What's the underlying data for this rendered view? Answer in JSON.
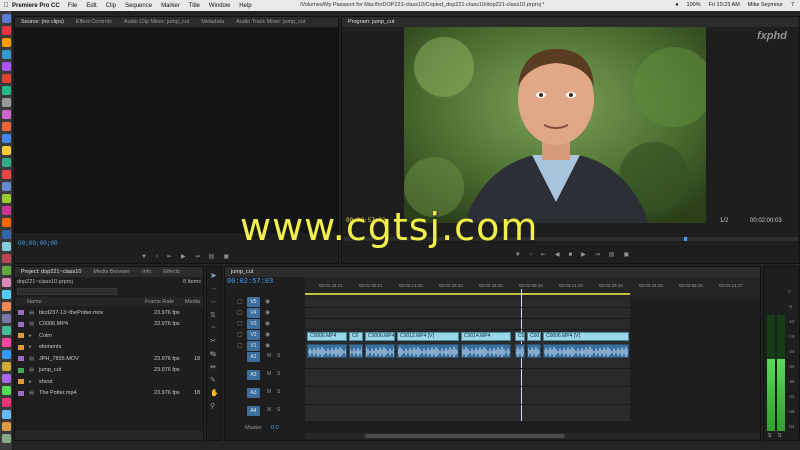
{
  "menubar": {
    "app": "Premiere Pro CC",
    "items": [
      "File",
      "Edit",
      "Clip",
      "Sequence",
      "Marker",
      "Title",
      "Window",
      "Help"
    ],
    "path": "/Volumes/My Passport for Mac/forDOP221-class10/Copied_dop221-class10/dop221-class10.prproj *",
    "battery": "100%",
    "time": "Fri 10:23 AM",
    "user": "Mike Seymour",
    "badge": "7"
  },
  "source_panel": {
    "tabs": [
      "Source: (no clips)",
      "Effect Controls",
      "Audio Clip Mixer: jump_cut",
      "Metadata",
      "Audio Track Mixer: jump_cut"
    ],
    "timecode": "00;00;00;00"
  },
  "program_panel": {
    "tab": "Program: jump_cut",
    "logo": "fxphd",
    "timecode_current": "00:02:57:03",
    "zoom": "1/2",
    "timecode_duration": "00:02:00:03"
  },
  "project_panel": {
    "tabs": [
      "Project: dop221~class10",
      "Media Browser",
      "Info",
      "Effects"
    ],
    "file": "dop221~class10.prproj",
    "items_count": "8 Items",
    "columns": [
      "Name",
      "Frame Rate",
      "Media"
    ],
    "rows": [
      {
        "name": "blcd237-13~thePotter.mov",
        "fps": "23.976 fps",
        "media": "",
        "color": "#9c6bc2"
      },
      {
        "name": "C0006.MP4",
        "fps": "23.976 fps",
        "media": "",
        "color": "#9c6bc2"
      },
      {
        "name": "Colm",
        "fps": "",
        "media": "",
        "color": "#e09a3a"
      },
      {
        "name": "elements",
        "fps": "",
        "media": "",
        "color": "#e09a3a"
      },
      {
        "name": "JPH_7895.MOV",
        "fps": "23.976 fps",
        "media": "18",
        "color": "#9c6bc2"
      },
      {
        "name": "jump_cut",
        "fps": "23.976 fps",
        "media": "",
        "color": "#3fae58"
      },
      {
        "name": "shoot",
        "fps": "",
        "media": "",
        "color": "#e09a3a"
      },
      {
        "name": "The Potter.mp4",
        "fps": "23.976 fps",
        "media": "18",
        "color": "#9c6bc2"
      }
    ]
  },
  "timeline": {
    "tab": "jump_cut",
    "timecode": "00:02:57:03",
    "ruler": [
      "00:01:44:21",
      "00:01:59:21",
      "00:02:14:20",
      "00:02:29:20",
      "00:02:44:20",
      "00:02:59:19",
      "00:03:14:19",
      "00:03:29:19",
      "00:03:44:18",
      "00:03:59:18",
      "00:04:14:17"
    ],
    "video_tracks": [
      "V5",
      "V4",
      "V3",
      "V2",
      "V1"
    ],
    "audio_tracks": [
      "A1",
      "A2",
      "A3",
      "A4"
    ],
    "master_label": "Master",
    "master_value": "0.0",
    "clips": [
      "C0006.MP4",
      "C0",
      "C0006.MP4",
      "C0012.MP4 [V]",
      "C0014.MP4",
      "C0",
      "C00",
      "C0006.MP4 [V]"
    ]
  },
  "meter": {
    "scale": [
      "0",
      "-6",
      "-12",
      "-18",
      "-24",
      "-30",
      "-36",
      "-42",
      "-48",
      "-54"
    ],
    "bottom": [
      "S",
      "S"
    ]
  },
  "watermark": "www.cgtsj.com",
  "colors": {
    "accent_yellow": "#e6d44a",
    "timecode_blue": "#3fa2ff",
    "clip_video": "#9ad8e8",
    "clip_audio": "#3b6f9b"
  }
}
